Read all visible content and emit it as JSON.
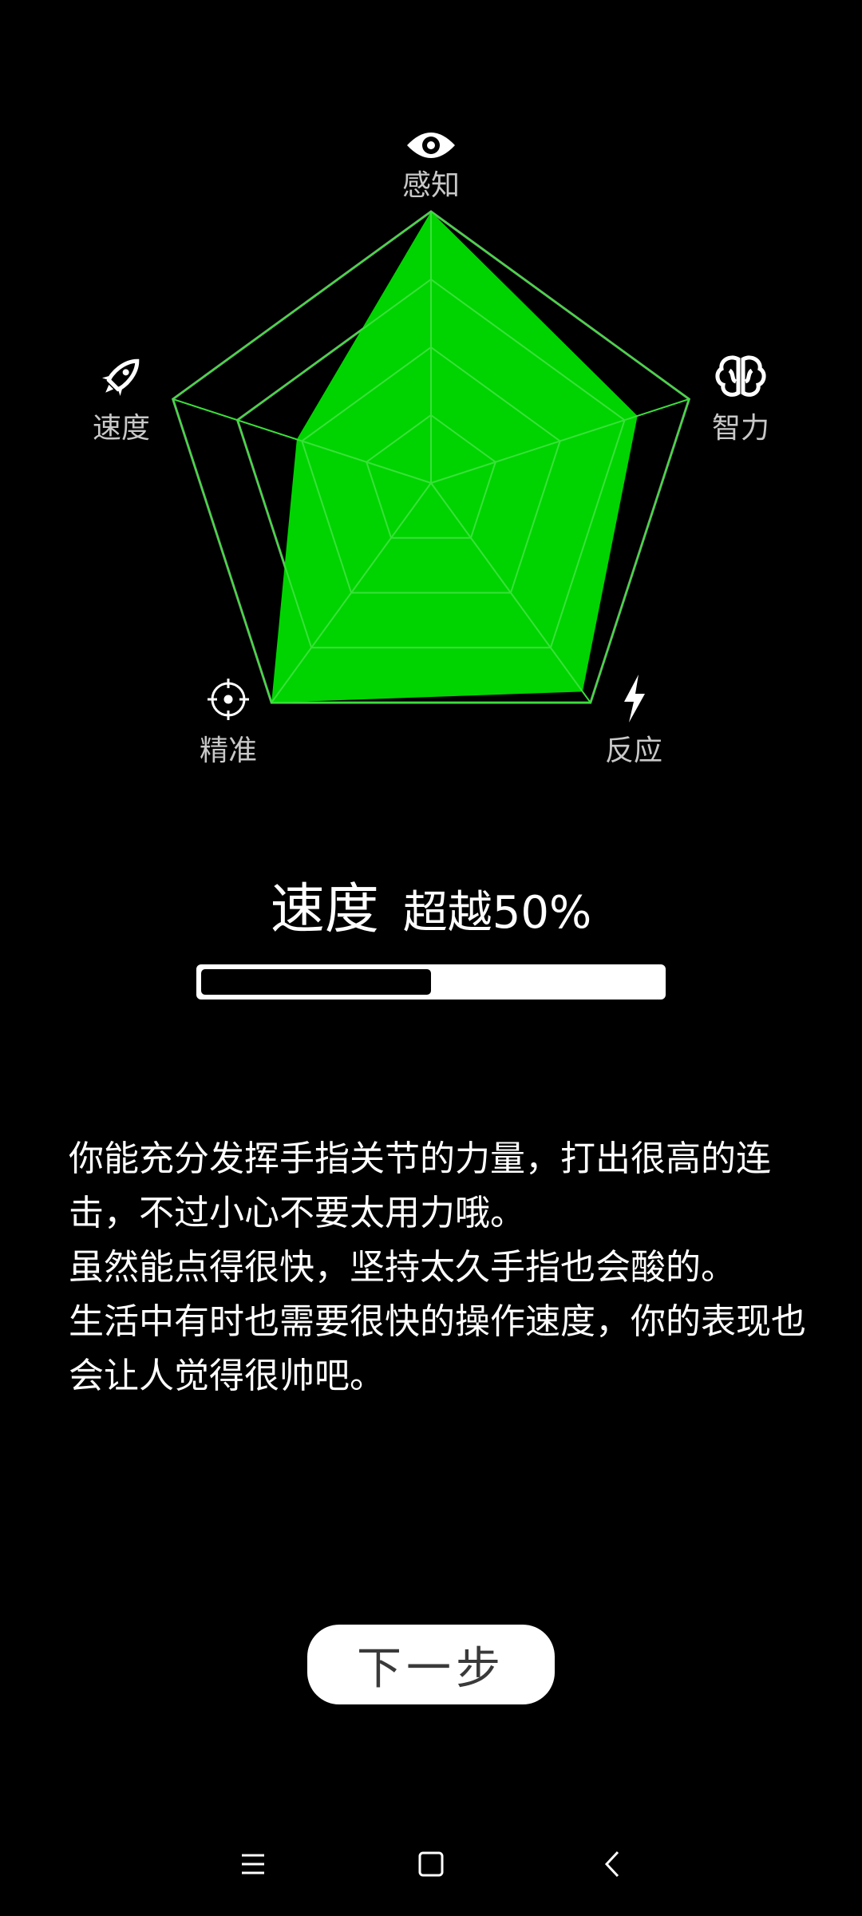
{
  "radar": {
    "axes": [
      {
        "label": "感知",
        "icon": "eye-icon",
        "value": 1.0
      },
      {
        "label": "智力",
        "icon": "brain-icon",
        "value": 0.8
      },
      {
        "label": "反应",
        "icon": "lightning-icon",
        "value": 0.95
      },
      {
        "label": "精准",
        "icon": "crosshair-icon",
        "value": 1.0
      },
      {
        "label": "速度",
        "icon": "rocket-icon",
        "value": 0.52
      }
    ],
    "levels": 4,
    "fill_color": "#00d400",
    "grid_color": "#8a8a8a"
  },
  "result": {
    "title": "速度",
    "percentile_text": "超越50%",
    "progress": 0.5
  },
  "description": [
    "你能充分发挥手指关节的力量，打出很高的连击，不过小心不要太用力哦。",
    "虽然能点得很快，坚持太久手指也会酸的。",
    "生活中有时也需要很快的操作速度，你的表现也会让人觉得很帅吧。"
  ],
  "next_button": {
    "label": "下一步"
  },
  "navbar": {
    "icons": [
      "menu-icon",
      "home-square-icon",
      "back-chevron-icon"
    ]
  }
}
